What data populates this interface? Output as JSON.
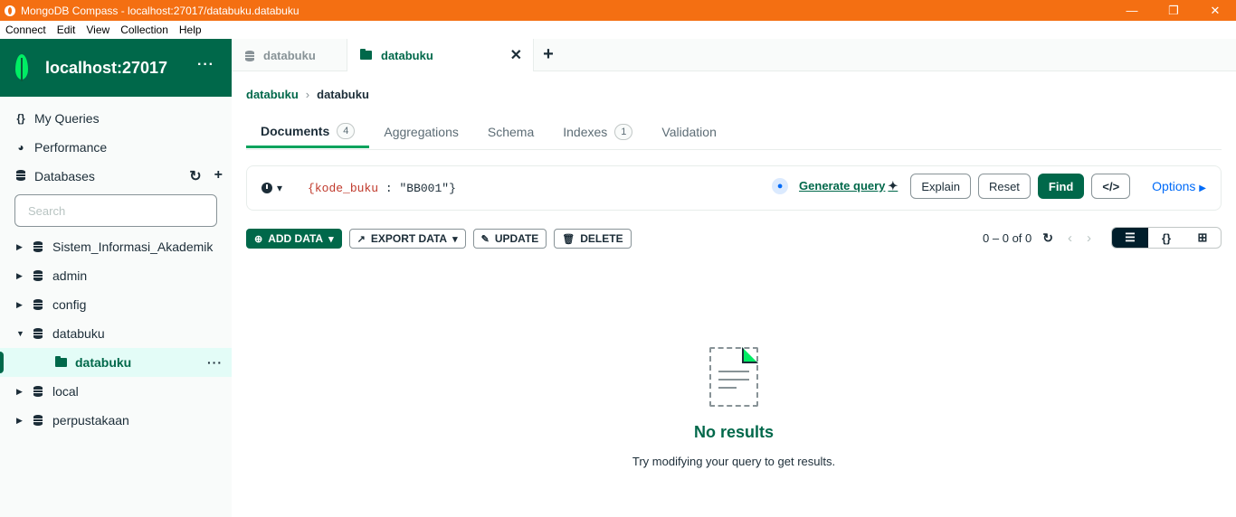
{
  "window": {
    "title": "MongoDB Compass - localhost:27017/databuku.databuku"
  },
  "menu": [
    "Connect",
    "Edit",
    "View",
    "Collection",
    "Help"
  ],
  "sidebar": {
    "connection_name": "localhost:27017",
    "nav": [
      {
        "label": "My Queries",
        "icon": "braces-icon"
      },
      {
        "label": "Performance",
        "icon": "gauge-icon"
      },
      {
        "label": "Databases",
        "icon": "database-icon"
      }
    ],
    "search_placeholder": "Search",
    "databases": [
      {
        "name": "Sistem_Informasi_Akademik",
        "expanded": false
      },
      {
        "name": "admin",
        "expanded": false
      },
      {
        "name": "config",
        "expanded": false
      },
      {
        "name": "databuku",
        "expanded": true,
        "collections": [
          "databuku"
        ]
      },
      {
        "name": "local",
        "expanded": false
      },
      {
        "name": "perpustakaan",
        "expanded": false
      }
    ]
  },
  "tabs": [
    {
      "label": "databuku",
      "active": false
    },
    {
      "label": "databuku",
      "active": true
    }
  ],
  "breadcrumb": {
    "database": "databuku",
    "collection": "databuku"
  },
  "subtabs": [
    {
      "label": "Documents",
      "badge": "4",
      "active": true
    },
    {
      "label": "Aggregations"
    },
    {
      "label": "Schema"
    },
    {
      "label": "Indexes",
      "badge": "1"
    },
    {
      "label": "Validation"
    }
  ],
  "query": {
    "open": "{",
    "key": "kode_buku",
    "colon": " : ",
    "value": "\"BB001\"",
    "close": "}",
    "generate_label": "Generate query",
    "explain_label": "Explain",
    "reset_label": "Reset",
    "find_label": "Find",
    "code_label": "</>",
    "options_label": "Options"
  },
  "toolbar": {
    "add_data": "ADD DATA",
    "export_data": "EXPORT DATA",
    "update": "UPDATE",
    "delete": "DELETE",
    "pagination": "0 – 0 of 0"
  },
  "empty_state": {
    "title": "No results",
    "subtitle": "Try modifying your query to get results."
  },
  "colors": {
    "titlebar": "#f46f12",
    "brand_green": "#00684a",
    "accent_green": "#00ed64",
    "link_blue": "#016bf8"
  }
}
